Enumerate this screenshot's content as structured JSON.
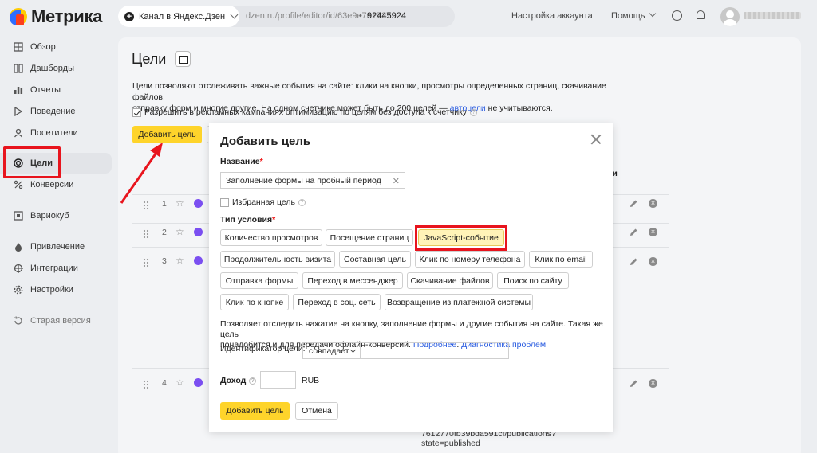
{
  "topbar": {
    "logo_text": "Метрика",
    "counter_label": "Канал в Яндекс.Дзен",
    "counter_url": "dzen.ru/profile/editor/id/63e9e761727...",
    "counter_id": "92445924",
    "account_settings": "Настройка аккаунта",
    "help": "Помощь"
  },
  "sidebar": {
    "items": [
      {
        "label": "Обзор",
        "icon": "grid-icon"
      },
      {
        "label": "Дашборды",
        "icon": "dashboard-icon"
      },
      {
        "label": "Отчеты",
        "icon": "reports-icon"
      },
      {
        "label": "Поведение",
        "icon": "play-icon"
      },
      {
        "label": "Посетители",
        "icon": "visitors-icon"
      },
      {
        "label": "Цели",
        "icon": "target-icon"
      },
      {
        "label": "Конверсии",
        "icon": "percent-icon"
      },
      {
        "label": "Вариокуб",
        "icon": "variocube-icon"
      },
      {
        "label": "Привлечение",
        "icon": "flame-icon"
      },
      {
        "label": "Интеграции",
        "icon": "integrations-icon"
      },
      {
        "label": "Настройки",
        "icon": "gear-icon"
      },
      {
        "label": "Старая версия",
        "icon": "history-icon"
      }
    ],
    "active": "Цели"
  },
  "page": {
    "title": "Цели",
    "description_1": "Цели позволяют отслеживать важные события на сайте: клики на кнопки, просмотры определенных страниц, скачивание файлов,",
    "description_2a": "отправку форм и многие другие. На одном счетчике может быть до 200 целей — ",
    "description_link": "автоцели",
    "description_2b": " не учитываются.",
    "permission_label": "Разрешить в рекламных кампаниях оптимизацию по целям без доступа к счетчику",
    "add_goal_button": "Добавить цель",
    "column_header": "Ли",
    "rows": [
      {
        "num": "1"
      },
      {
        "num": "2"
      },
      {
        "num": "3"
      },
      {
        "num": "4"
      }
    ],
    "url_fragment_1": "7612770fb39bda591cf/publications?",
    "url_fragment_2": "state=published"
  },
  "modal": {
    "title": "Добавить цель",
    "name_label": "Название",
    "name_value": "Заполнение формы на пробный период",
    "favorite_label": "Избранная цель",
    "condition_label": "Тип условия",
    "condition_types": [
      "Количество просмотров",
      "Посещение страниц",
      "JavaScript-событие",
      "Продолжительность визита",
      "Составная цель",
      "Клик по номеру телефона",
      "Клик по email",
      "Отправка формы",
      "Переход в мессенджер",
      "Скачивание файлов",
      "Поиск по сайту",
      "Клик по кнопке",
      "Переход в соц. сеть",
      "Возвращение из платежной системы"
    ],
    "selected_condition": "JavaScript-событие",
    "info_text_1": "Позволяет отследить нажатие на кнопку, заполнение формы и другие события на сайте. Такая же цель",
    "info_text_2": "понадобится и для передачи офлайн-конверсий. ",
    "info_link_1": "Подробнее",
    "info_link_2": "Диагностика проблем",
    "id_label": "Идентификатор цели:",
    "id_match": "совпадает",
    "income_label": "Доход",
    "currency": "RUB",
    "submit": "Добавить цель",
    "cancel": "Отмена"
  },
  "colors": {
    "accent_yellow": "#fed42b",
    "highlight_red": "#e8141d",
    "link_blue": "#2a5ce0",
    "selected_chip": "#fff3b8"
  }
}
